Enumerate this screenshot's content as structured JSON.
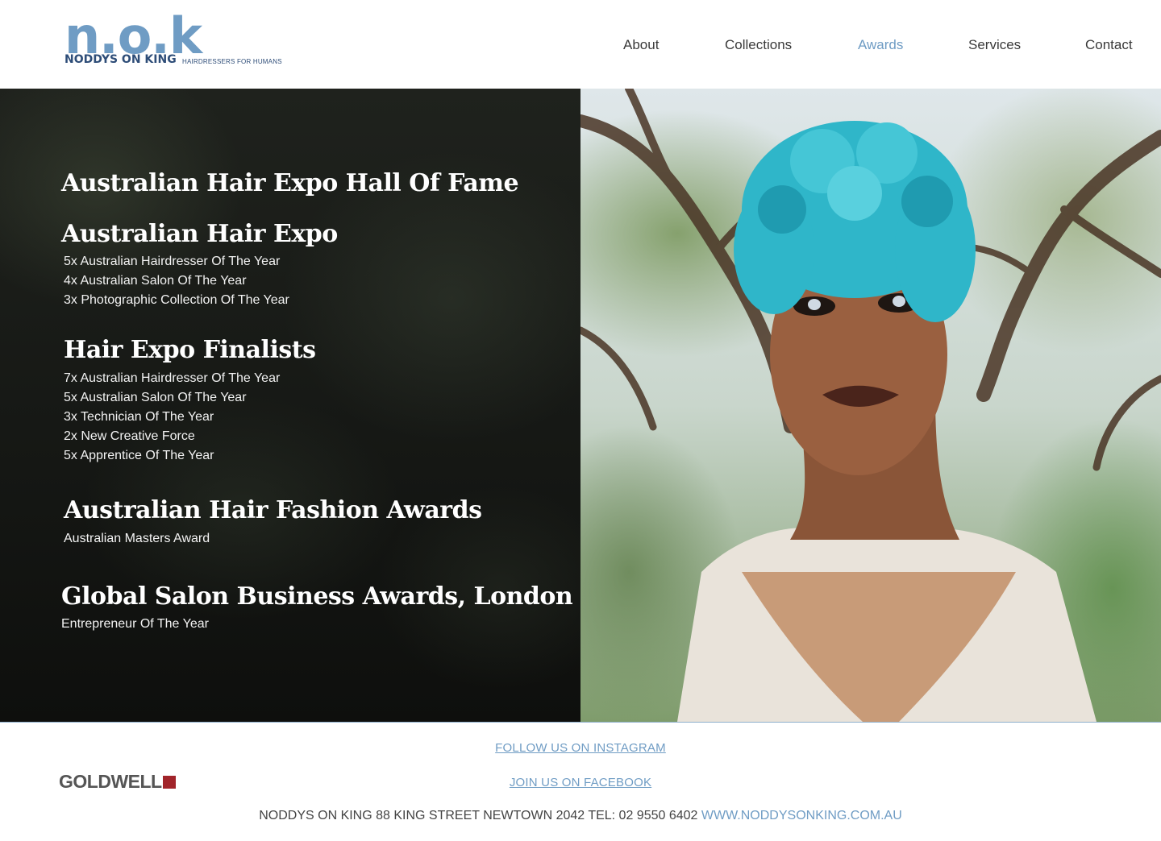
{
  "brand": {
    "logo_mark": "n.o.k",
    "name": "NODDYS ON KING",
    "tagline": "HAIRDRESSERS FOR HUMANS"
  },
  "nav": {
    "items": [
      {
        "label": "About"
      },
      {
        "label": "Collections"
      },
      {
        "label": "Awards"
      },
      {
        "label": "Services"
      },
      {
        "label": "Contact"
      }
    ],
    "active": "Awards"
  },
  "awards": {
    "hall_of_fame": "Australian Hair Expo Hall Of Fame",
    "expo": {
      "title": "Australian Hair Expo",
      "items": [
        "5x Australian Hairdresser Of The Year",
        "4x Australian Salon Of The Year",
        "3x Photographic Collection Of The Year"
      ]
    },
    "finalists": {
      "title": "Hair Expo Finalists",
      "items": [
        "7x Australian Hairdresser Of The Year",
        "5x Australian Salon Of The Year",
        "3x Technician Of The Year",
        "2x New Creative Force",
        "5x Apprentice Of The Year"
      ]
    },
    "fashion": {
      "title": "Australian Hair Fashion Awards",
      "items": [
        "Australian Masters Award"
      ]
    },
    "global": {
      "title": "Global Salon Business Awards, London",
      "items": [
        "Entrepreneur Of The Year"
      ]
    }
  },
  "footer": {
    "partner_logo": "GOLDWELL",
    "instagram_link": "FOLLOW US ON INSTAGRAM",
    "facebook_link": "JOIN US ON FACEBOOK",
    "address": "NODDYS ON KING 88 KING STREET NEWTOWN 2042 TEL: 02 9550 6402",
    "website": "WWW.NODDYSONKING.COM.AU"
  },
  "colors": {
    "accent": "#6f9cc4",
    "brand_dark": "#2e4d78",
    "goldwell_red": "#a1242a",
    "hair_teal": "#2fb6c9"
  }
}
